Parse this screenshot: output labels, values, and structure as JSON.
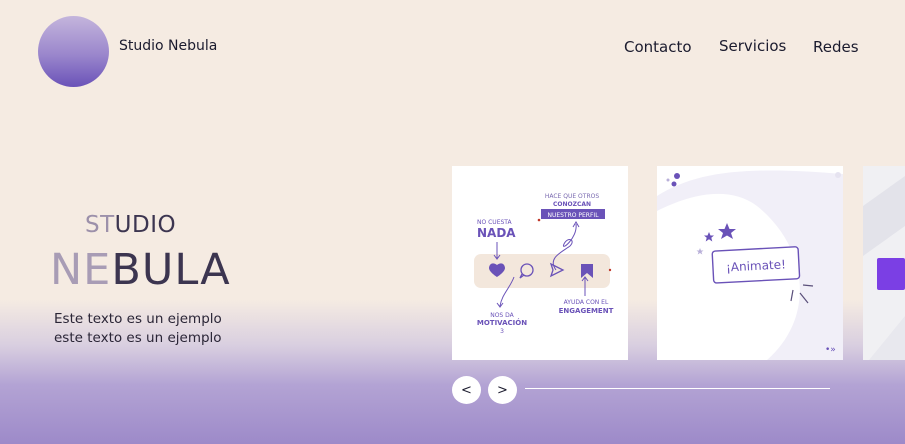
{
  "header": {
    "brand": "Studio Nebula",
    "nav": {
      "contact": "Contacto",
      "services": "Servicios",
      "social": "Redes"
    }
  },
  "hero": {
    "studio_a": "ST",
    "studio_b": "UDIO",
    "nebula_a": "NE",
    "nebula_b": "BULA",
    "desc_line1": "Este texto es un ejemplo",
    "desc_line2": "este texto es un ejemplo"
  },
  "carousel": {
    "card1": {
      "no_cuesta": "NO CUESTA",
      "nada": "NADA",
      "hace_line1": "HACE QUE OTROS",
      "hace_line2": "CONOZCAN",
      "hace_line3": "NUESTRO PERFIL",
      "ayuda_line1": "AYUDA CON EL",
      "ayuda_line2": "ENGAGEMENT",
      "nos_line1": "NOS DA",
      "nos_line2": "MOTIVACIÓN",
      "nos_line3": "3"
    },
    "card2": {
      "button_text": "¡Animate!",
      "corner_mark": "•»"
    },
    "prev_label": "<",
    "next_label": ">"
  },
  "colors": {
    "background": "#f5ebe2",
    "accent_purple": "#6a52b8",
    "card_beige": "#f3e7dc"
  }
}
